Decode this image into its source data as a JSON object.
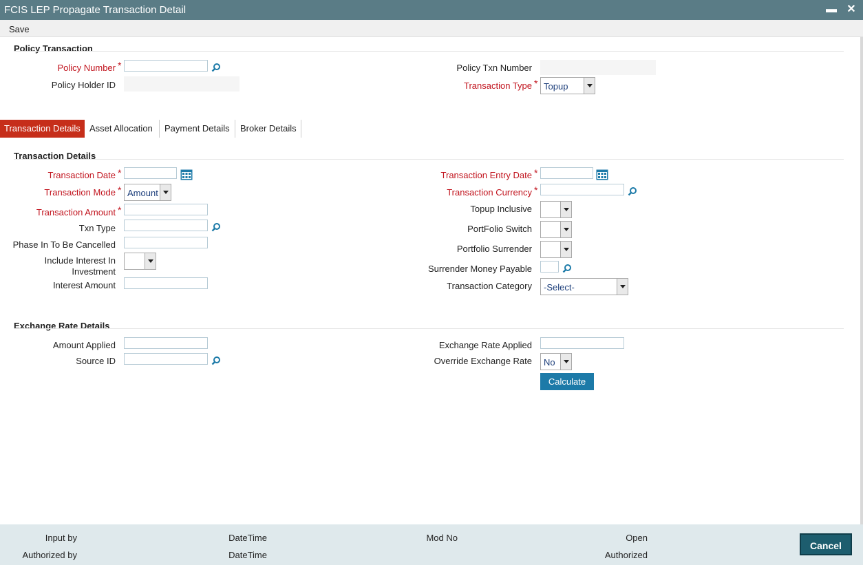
{
  "window": {
    "title": "FCIS LEP Propagate Transaction Detail",
    "minimize": "▬",
    "close": "✕"
  },
  "toolbar": {
    "save": "Save"
  },
  "policy": {
    "section_title": "Policy Transaction",
    "policy_number_label": "Policy Number",
    "policy_number_value": "",
    "policy_holder_label": "Policy Holder ID",
    "policy_txn_number_label": "Policy Txn Number",
    "transaction_type_label": "Transaction Type",
    "transaction_type_value": "Topup"
  },
  "tabs": [
    {
      "label": "Transaction Details",
      "active": true
    },
    {
      "label": "Asset Allocation",
      "active": false
    },
    {
      "label": "Payment Details",
      "active": false
    },
    {
      "label": "Broker Details",
      "active": false
    }
  ],
  "txn": {
    "section_title": "Transaction Details",
    "transaction_date_label": "Transaction Date",
    "transaction_mode_label": "Transaction Mode",
    "transaction_mode_value": "Amount",
    "transaction_amount_label": "Transaction Amount",
    "txn_type_label": "Txn Type",
    "phase_in_label": "Phase In To Be Cancelled",
    "include_interest_label_1": "Include Interest In",
    "include_interest_label_2": "Investment",
    "interest_amount_label": "Interest Amount",
    "entry_date_label": "Transaction Entry Date",
    "currency_label": "Transaction Currency",
    "topup_inclusive_label": "Topup Inclusive",
    "portfolio_switch_label": "PortFolio Switch",
    "portfolio_surrender_label": "Portfolio Surrender",
    "surrender_money_label": "Surrender Money Payable",
    "category_label": "Transaction Category",
    "category_value": "-Select-"
  },
  "exchange": {
    "section_title": "Exchange Rate Details",
    "amount_applied_label": "Amount Applied",
    "source_id_label": "Source ID",
    "rate_applied_label": "Exchange Rate Applied",
    "override_label": "Override Exchange Rate",
    "override_value": "No",
    "calculate": "Calculate"
  },
  "footer": {
    "input_by": "Input by",
    "authorized_by": "Authorized by",
    "datetime_1": "DateTime",
    "datetime_2": "DateTime",
    "mod_no": "Mod No",
    "open": "Open",
    "authorized": "Authorized",
    "cancel": "Cancel"
  },
  "colors": {
    "title_bar": "#5a7c86",
    "required": "#c1121c",
    "active_tab": "#c62e1a",
    "accent_button": "#1c7aa8",
    "cancel_button": "#1d5d6e",
    "footer": "#dfe9ec"
  },
  "icons": {
    "lookup": "search-icon",
    "calendar": "calendar-icon"
  }
}
